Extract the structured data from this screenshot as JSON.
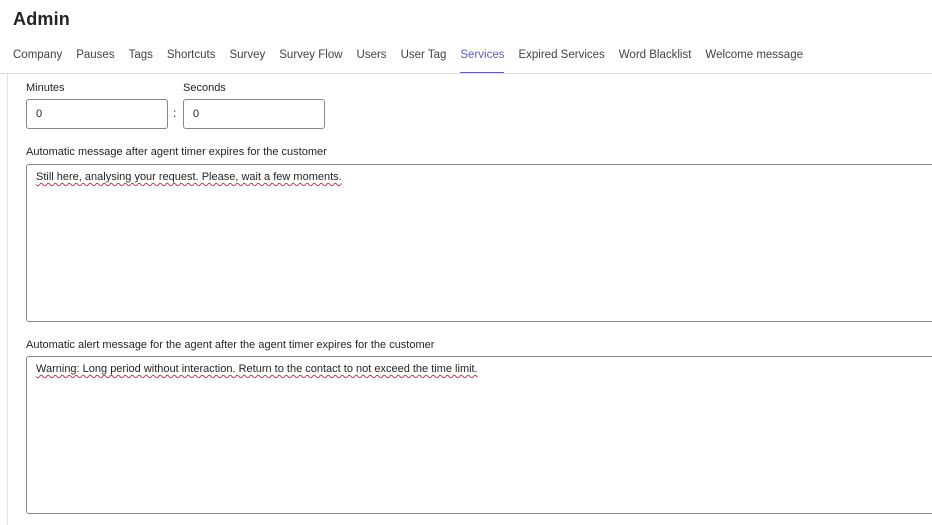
{
  "page": {
    "title": "Admin"
  },
  "tabs": [
    {
      "label": "Company",
      "active": false
    },
    {
      "label": "Pauses",
      "active": false
    },
    {
      "label": "Tags",
      "active": false
    },
    {
      "label": "Shortcuts",
      "active": false
    },
    {
      "label": "Survey",
      "active": false
    },
    {
      "label": "Survey Flow",
      "active": false
    },
    {
      "label": "Users",
      "active": false
    },
    {
      "label": "User Tag",
      "active": false
    },
    {
      "label": "Services",
      "active": true
    },
    {
      "label": "Expired Services",
      "active": false
    },
    {
      "label": "Word Blacklist",
      "active": false
    },
    {
      "label": "Welcome message",
      "active": false
    }
  ],
  "timer": {
    "minutes_label": "Minutes",
    "minutes_value": "0",
    "separator": ":",
    "seconds_label": "Seconds",
    "seconds_value": "0"
  },
  "customer_message": {
    "label": "Automatic message after agent timer expires for the customer",
    "value": "Still here, analysing your request. Please, wait a few moments."
  },
  "agent_alert": {
    "label": "Automatic alert message for the agent after the agent timer expires for the customer",
    "value": "Warning: Long period without interaction. Return to the contact to not exceed the time limit."
  },
  "colors": {
    "accent": "#5b5fc7",
    "text": "#242424",
    "border": "#8a8886",
    "spellcheck": "#d13438"
  }
}
